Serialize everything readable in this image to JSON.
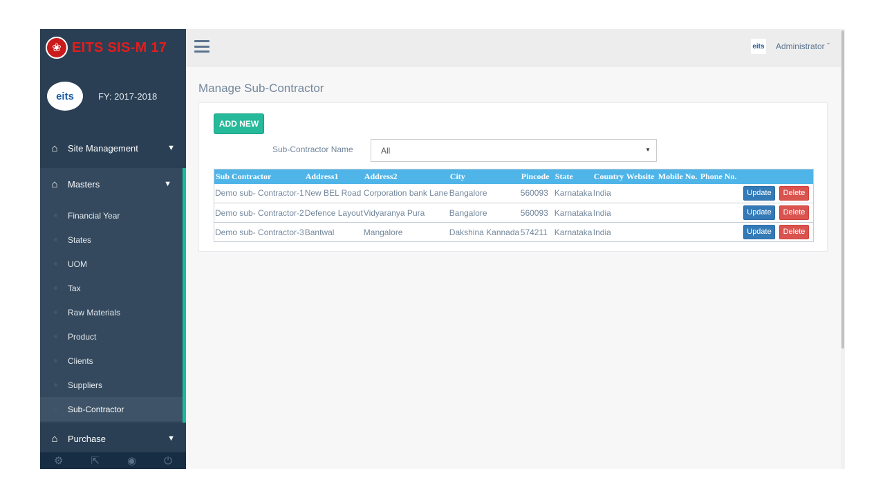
{
  "sidebar": {
    "brand_title": "EITS SIS-M 17",
    "brand_logo_glyph": "❀",
    "fy_logo_text": "eits",
    "fy_label": "FY: 2017-2018",
    "sections": {
      "site": "Site Management",
      "masters": "Masters",
      "purchase": "Purchase"
    },
    "items": [
      "Financial Year",
      "States",
      "UOM",
      "Tax",
      "Raw Materials",
      "Product",
      "Clients",
      "Suppliers",
      "Sub-Contractor"
    ],
    "active_item": "Sub-Contractor",
    "footer_icons": [
      "settings-icon",
      "fullscreen-icon",
      "eye-off-icon",
      "power-icon"
    ]
  },
  "topnav": {
    "user_name": "Administrator",
    "avatar_text": "eits"
  },
  "page": {
    "title": "Manage Sub-Contractor",
    "add_button": "ADD NEW",
    "filter_label": "Sub-Contractor Name",
    "filter_value": "All"
  },
  "table": {
    "headers": [
      "Sub Contractor",
      "Address1",
      "Address2",
      "City",
      "Pincode",
      "State",
      "Country",
      "Website",
      "Mobile No.",
      "Phone No."
    ],
    "rows": [
      [
        "Demo sub- Contractor-1",
        "New BEL Road",
        "Corporation bank Lane",
        "Bangalore",
        "560093",
        "Karnataka",
        "India",
        "",
        "",
        ""
      ],
      [
        "Demo sub- Contractor-2",
        "Defence Layout",
        "Vidyaranya Pura",
        "Bangalore",
        "560093",
        "Karnataka",
        "India",
        "",
        "",
        ""
      ],
      [
        "Demo sub- Contractor-3",
        "Bantwal",
        "Mangalore",
        "Dakshina Kannada",
        "574211",
        "Karnataka",
        "India",
        "",
        "",
        ""
      ]
    ],
    "update_label": "Update",
    "delete_label": "Delete"
  },
  "colors": {
    "sidebar_bg": "#2a3f54",
    "accent": "#1abb9c",
    "brand_red": "#e31d1d",
    "table_header": "#4fb5e9",
    "update_btn": "#337ab7",
    "delete_btn": "#d9534f"
  }
}
